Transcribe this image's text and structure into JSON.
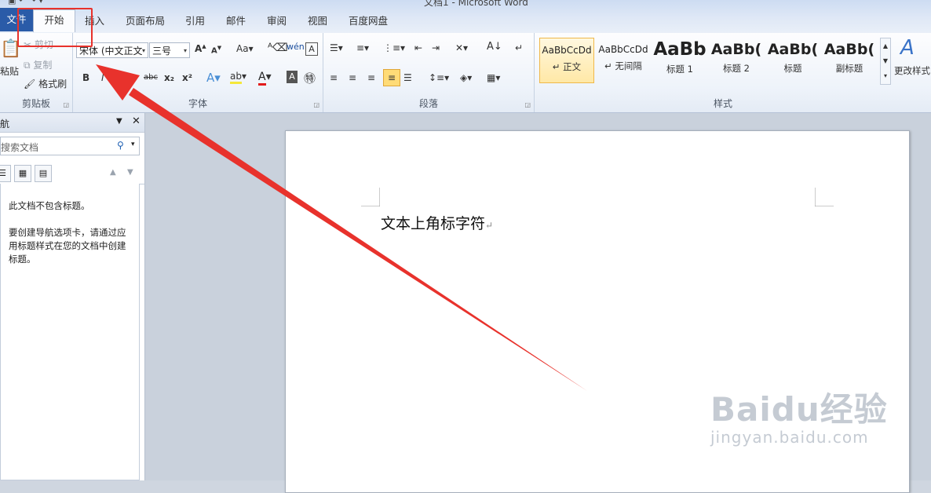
{
  "window": {
    "title": "文档1 - Microsoft Word",
    "qat_icons": [
      "save-icon",
      "undo-icon",
      "redo-icon",
      "qat-dropdown-icon"
    ]
  },
  "tabs": {
    "file": "文件",
    "home": "开始",
    "insert": "插入",
    "page_layout": "页面布局",
    "references": "引用",
    "mailings": "邮件",
    "review": "审阅",
    "view": "视图",
    "baidu_netdisk": "百度网盘"
  },
  "clipboard": {
    "paste": "粘贴",
    "cut": "剪切",
    "copy": "复制",
    "format_painter": "格式刷",
    "label": "剪贴板"
  },
  "font": {
    "font_name": "宋体 (中文正文",
    "font_size": "三号",
    "grow_icon": "A",
    "shrink_icon": "A",
    "case_icon": "Aa",
    "bold": "B",
    "italic": "I",
    "strikethrough": "abc",
    "subscript": "x₂",
    "superscript": "x²",
    "label": "字体"
  },
  "paragraph": {
    "label": "段落"
  },
  "styles": {
    "items": [
      {
        "sample": "AaBbCcDd",
        "name": "↵ 正文"
      },
      {
        "sample": "AaBbCcDd",
        "name": "↵ 无间隔"
      },
      {
        "sample": "AaBb",
        "name": "标题 1"
      },
      {
        "sample": "AaBb(",
        "name": "标题 2"
      },
      {
        "sample": "AaBb(",
        "name": "标题"
      },
      {
        "sample": "AaBb(",
        "name": "副标题"
      }
    ],
    "change_styles": "更改样式",
    "label": "样式"
  },
  "nav_pane": {
    "title": "航",
    "search_placeholder": "搜索文档",
    "no_headings": "此文档不包含标题。",
    "help_text": "要创建导航选项卡，请通过应用标题样式在您的文档中创建标题。"
  },
  "document": {
    "text": "文本上角标字符"
  },
  "watermark": {
    "main": "Baidu经验",
    "sub": "jingyan.baidu.com"
  },
  "colors": {
    "annotation_red": "#e8322c",
    "file_tab": "#2a5ba8"
  }
}
